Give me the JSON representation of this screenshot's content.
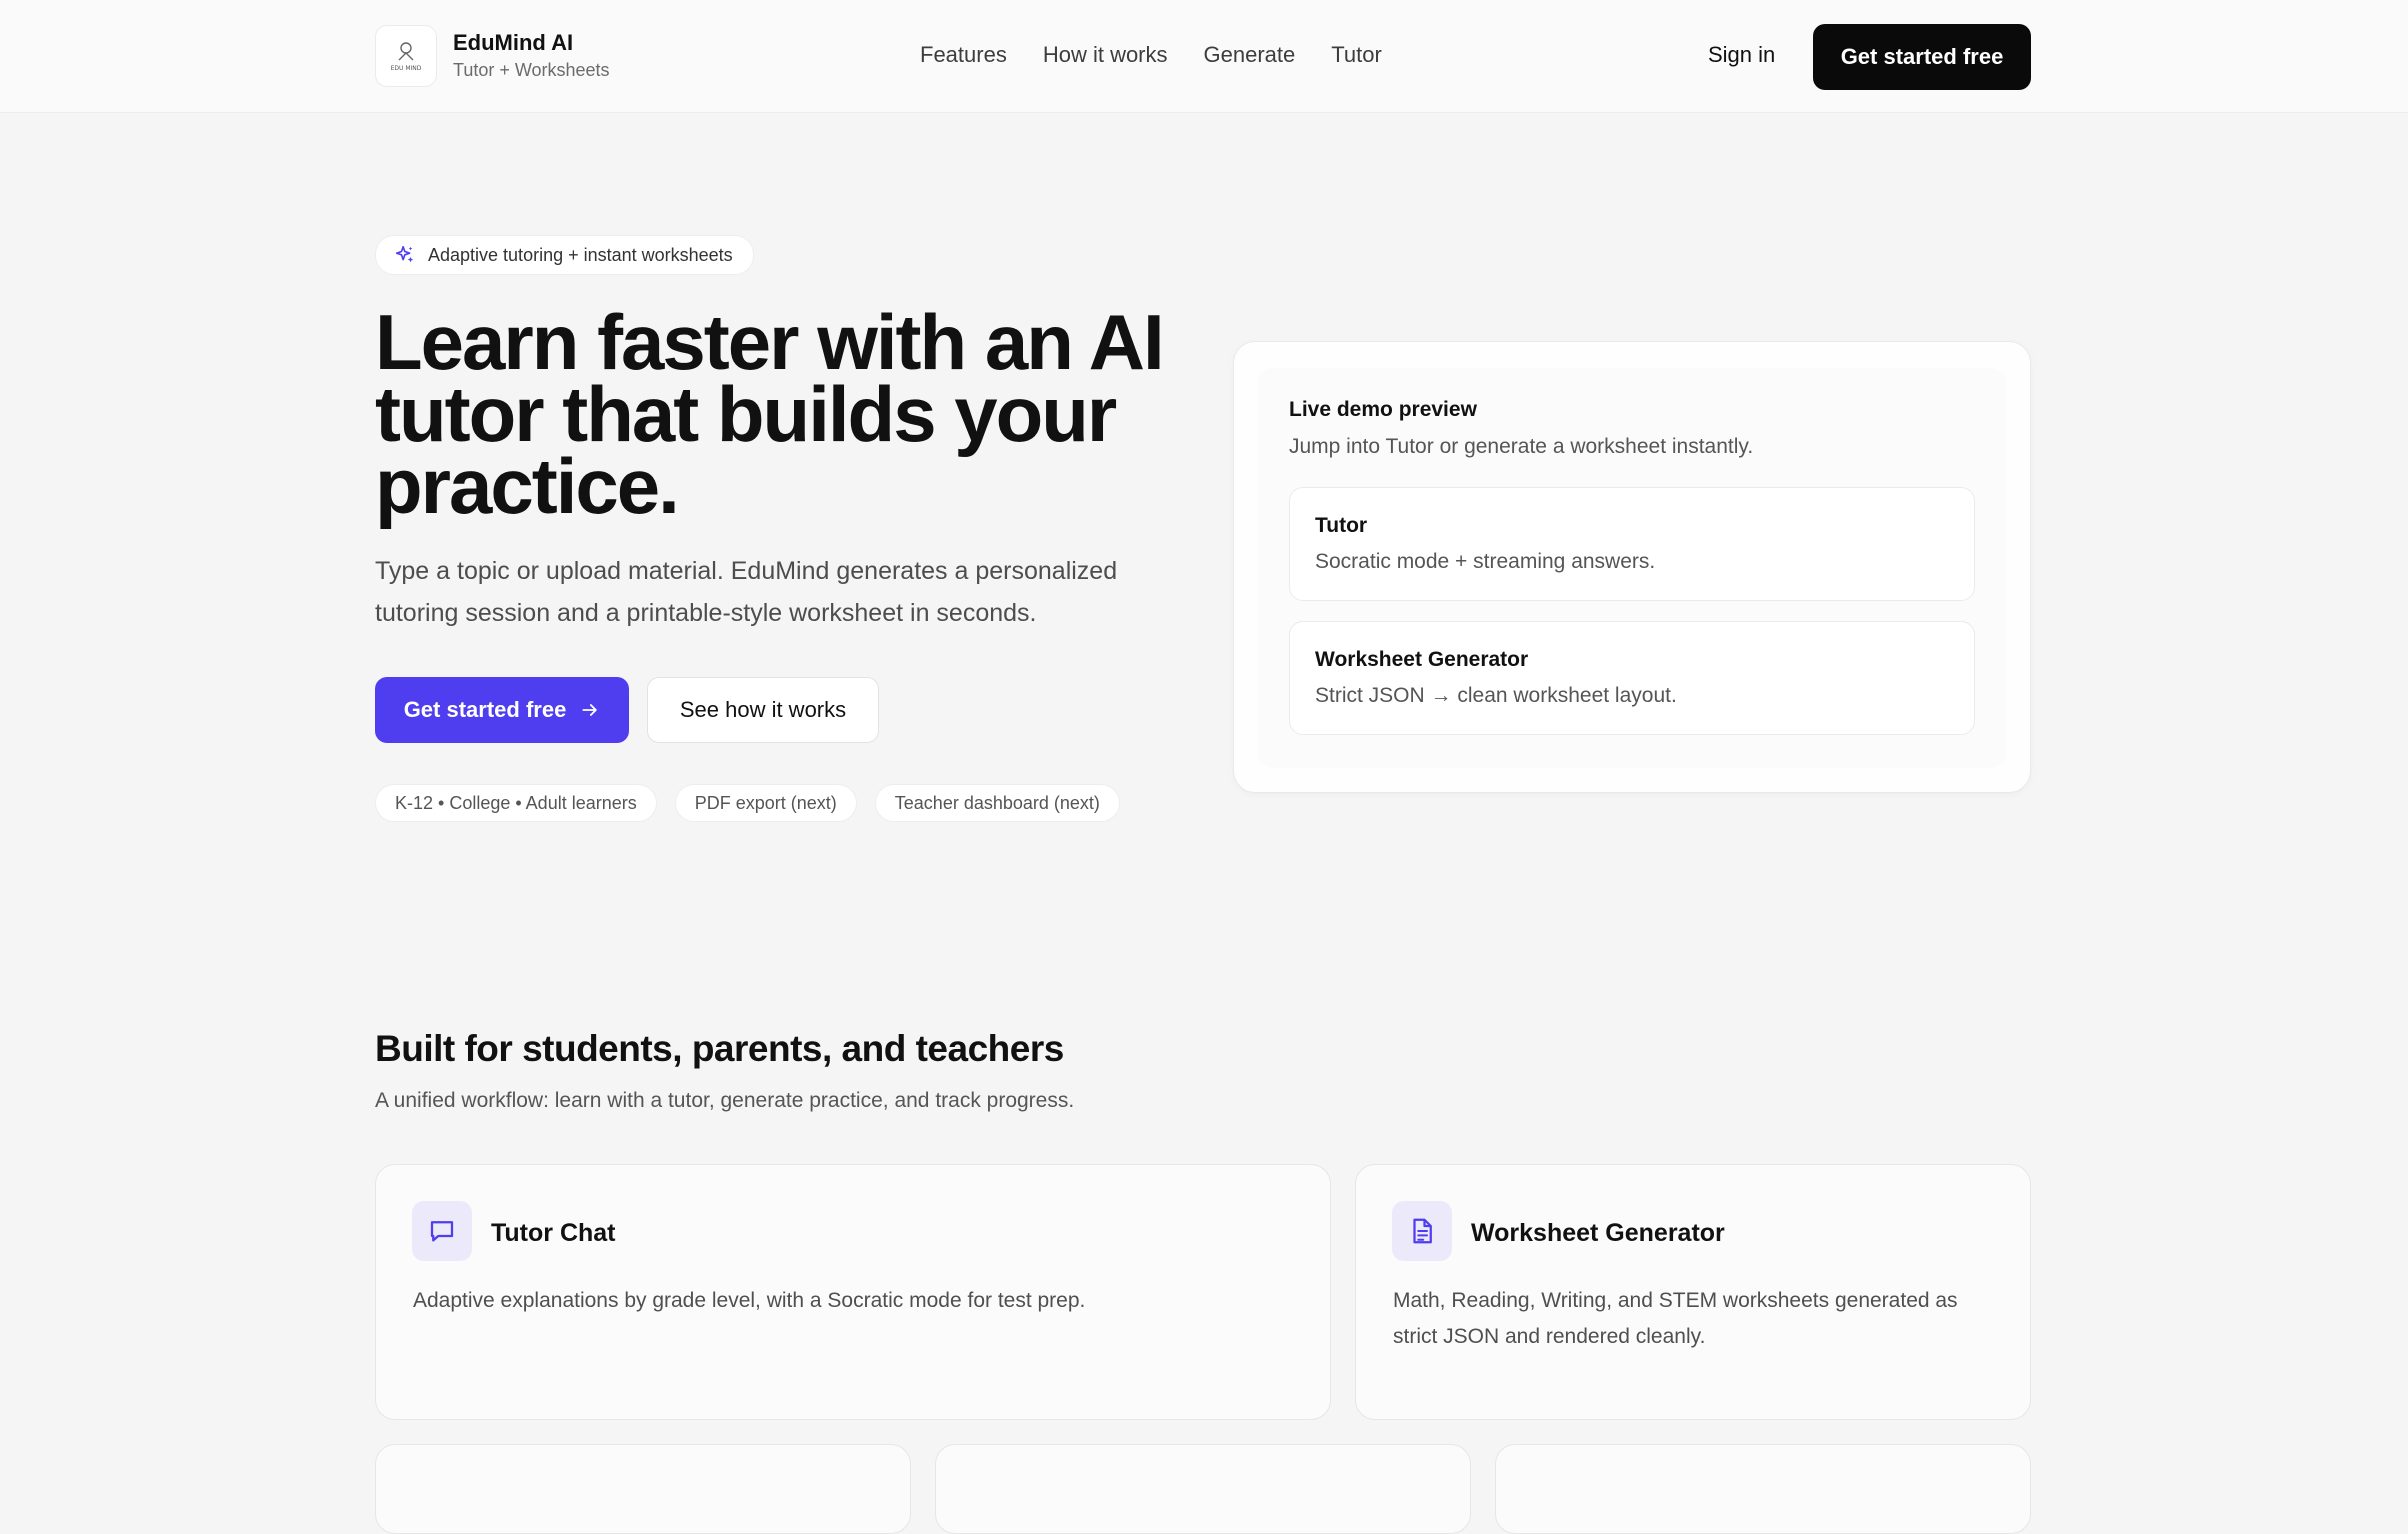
{
  "header": {
    "brand_name": "EduMind AI",
    "brand_tagline": "Tutor + Worksheets",
    "logo_text": "EDU MIND",
    "nav": [
      {
        "label": "Features"
      },
      {
        "label": "How it works"
      },
      {
        "label": "Generate"
      },
      {
        "label": "Tutor"
      }
    ],
    "signin_label": "Sign in",
    "cta_label": "Get started free"
  },
  "hero": {
    "badge": "Adaptive tutoring + instant worksheets",
    "title": "Learn faster with an AI tutor that builds your practice.",
    "subtitle": "Type a topic or upload material. EduMind generates a personalized tutoring session and a printable-style worksheet in seconds.",
    "primary_cta": "Get started free",
    "secondary_cta": "See how it works",
    "chips": [
      "K-12 • College • Adult learners",
      "PDF export (next)",
      "Teacher dashboard (next)"
    ]
  },
  "demo": {
    "title": "Live demo preview",
    "subtitle": "Jump into Tutor or generate a worksheet instantly.",
    "items": [
      {
        "title": "Tutor",
        "desc": "Socratic mode + streaming answers."
      },
      {
        "title": "Worksheet Generator",
        "desc": "Strict JSON → clean worksheet layout."
      }
    ]
  },
  "features": {
    "title": "Built for students, parents, and teachers",
    "subtitle": "A unified workflow: learn with a tutor, generate practice, and track progress.",
    "cards": [
      {
        "title": "Tutor Chat",
        "desc": "Adaptive explanations by grade level, with a Socratic mode for test prep.",
        "icon": "chat-bubble-icon"
      },
      {
        "title": "Worksheet Generator",
        "desc": "Math, Reading, Writing, and STEM worksheets generated as strict JSON and rendered cleanly.",
        "icon": "document-icon"
      }
    ]
  },
  "colors": {
    "accent": "#4f3df0",
    "dark_button": "#0a0a0a",
    "background": "#f5f5f5",
    "icon_tint": "#ece9fb"
  }
}
